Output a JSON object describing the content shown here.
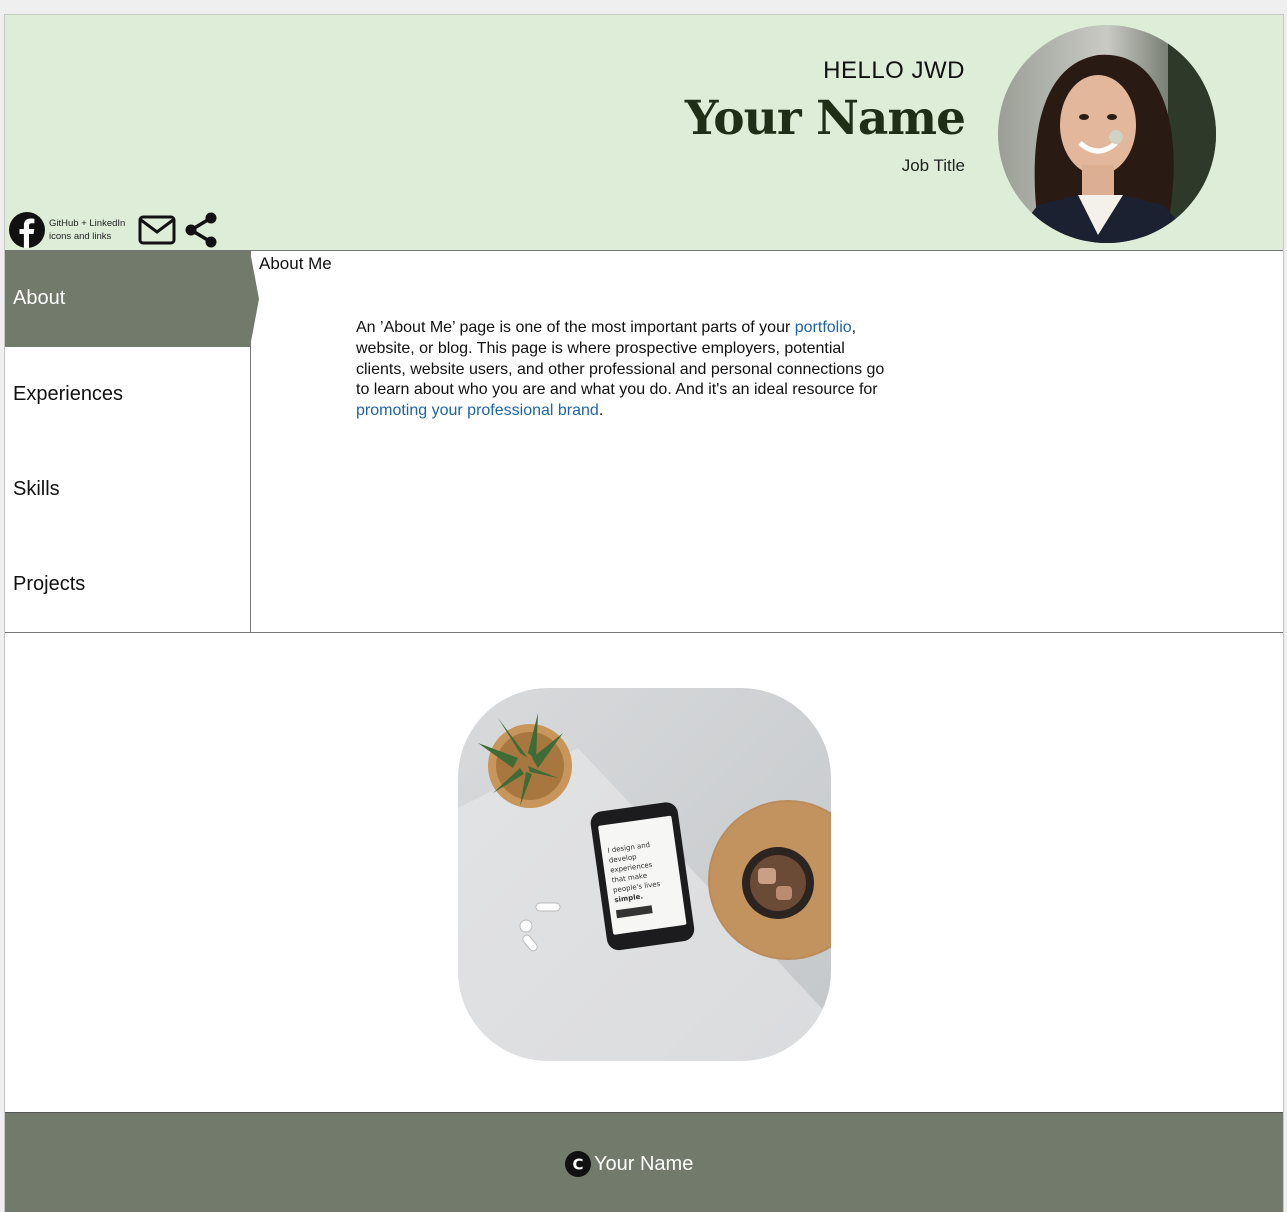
{
  "header": {
    "greeting": "HELLO JWD",
    "name": "Your Name",
    "job_title": "Job Title",
    "background_color": "#deedd8"
  },
  "social": {
    "note": "GitHub + LinkedIn icons and links",
    "icons": [
      "facebook-icon",
      "mail-icon",
      "share-icon"
    ]
  },
  "nav": {
    "items": [
      {
        "label": "About",
        "active": true
      },
      {
        "label": "Experiences",
        "active": false
      },
      {
        "label": "Skills",
        "active": false
      },
      {
        "label": "Projects",
        "active": false
      }
    ],
    "active_color": "#727a6b"
  },
  "about": {
    "title": "About Me",
    "text_1": "An ’About Me’ page is one of the most important parts of your ",
    "link_1": "portfolio",
    "text_2": ", website, or blog. This page is where prospective employers, potential clients, website users, and other professional and personal connections go to learn about who you are and what you do. And it's an ideal resource for ",
    "link_2": "promoting your professional brand",
    "text_3": "."
  },
  "footer": {
    "copyright_symbol": "C",
    "name": "Your Name",
    "background_color": "#727a6b"
  }
}
